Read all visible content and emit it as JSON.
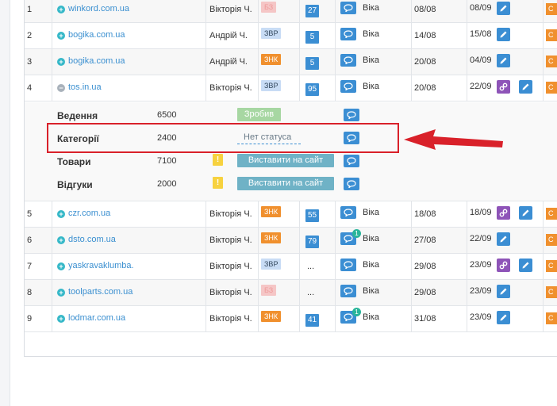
{
  "rows_top": [
    {
      "num": "1",
      "site": "winkord.com.ua",
      "manager": "Вікторія Ч.",
      "tag": "БЗ",
      "tag_type": "bz",
      "count": "27",
      "author": "Віка",
      "date1": "08/08",
      "date2": "08/09",
      "has_link": false,
      "stub": "С"
    },
    {
      "num": "2",
      "site": "bogika.com.ua",
      "manager": "Андрій Ч.",
      "tag": "ЗВР",
      "tag_type": "zvr",
      "count": "5",
      "author": "Віка",
      "date1": "14/08",
      "date2": "15/08",
      "has_link": false,
      "stub": "С"
    },
    {
      "num": "3",
      "site": "bogika.com.ua",
      "manager": "Андрій Ч.",
      "tag": "ЗНК",
      "tag_type": "znk",
      "count": "5",
      "author": "Віка",
      "date1": "20/08",
      "date2": "04/09",
      "has_link": false,
      "stub": "С"
    },
    {
      "num": "4",
      "site": "tos.in.ua",
      "manager": "Вікторія Ч.",
      "tag": "ЗВР",
      "tag_type": "zvr",
      "count": "95",
      "author": "Віка",
      "date1": "20/08",
      "date2": "22/09",
      "has_link": true,
      "stub": "С",
      "expanded": true
    }
  ],
  "sub_rows": [
    {
      "name": "Ведення",
      "value": "6500",
      "status": "Зробив",
      "status_type": "done",
      "warn": ""
    },
    {
      "name": "Категорії",
      "value": "2400",
      "status": "Нет статуса",
      "status_type": "none",
      "warn": ""
    },
    {
      "name": "Товари",
      "value": "7100",
      "status": "Виставити на сайт",
      "status_type": "publish",
      "warn": "!"
    },
    {
      "name": "Відгуки",
      "value": "2000",
      "status": "Виставити на сайт",
      "status_type": "publish",
      "warn": "!"
    }
  ],
  "rows_bottom": [
    {
      "num": "5",
      "site": "czr.com.ua",
      "manager": "Вікторія Ч.",
      "tag": "ЗНК",
      "tag_type": "znk",
      "count": "55",
      "author": "Віка",
      "date1": "18/08",
      "date2": "18/09",
      "has_link": true,
      "stub": "С"
    },
    {
      "num": "6",
      "site": "dsto.com.ua",
      "manager": "Вікторія Ч.",
      "tag": "ЗНК",
      "tag_type": "znk",
      "count": "79",
      "author": "Віка",
      "badge": "1",
      "date1": "27/08",
      "date2": "22/09",
      "has_link": false,
      "stub": "С"
    },
    {
      "num": "7",
      "site": "yaskravaklumba.",
      "manager": "Вікторія Ч.",
      "tag": "ЗВР",
      "tag_type": "zvr",
      "count": "...",
      "author": "Віка",
      "date1": "29/08",
      "date2": "23/09",
      "has_link": true,
      "stub": "С"
    },
    {
      "num": "8",
      "site": "toolparts.com.ua",
      "manager": "Вікторія Ч.",
      "tag": "БЗ",
      "tag_type": "bz",
      "count": "...",
      "author": "Віка",
      "date1": "29/08",
      "date2": "23/09",
      "has_link": false,
      "stub": "С"
    },
    {
      "num": "9",
      "site": "lodmar.com.ua",
      "manager": "Вікторія Ч.",
      "tag": "ЗНК",
      "tag_type": "znk",
      "count": "41",
      "author": "Віка",
      "badge": "1",
      "date1": "31/08",
      "date2": "23/09",
      "has_link": false,
      "stub": "С"
    }
  ],
  "colors": {
    "accent": "#3b8ed3",
    "highlight": "#d9212a",
    "orange": "#f0902e",
    "link": "#3a8fd0"
  }
}
